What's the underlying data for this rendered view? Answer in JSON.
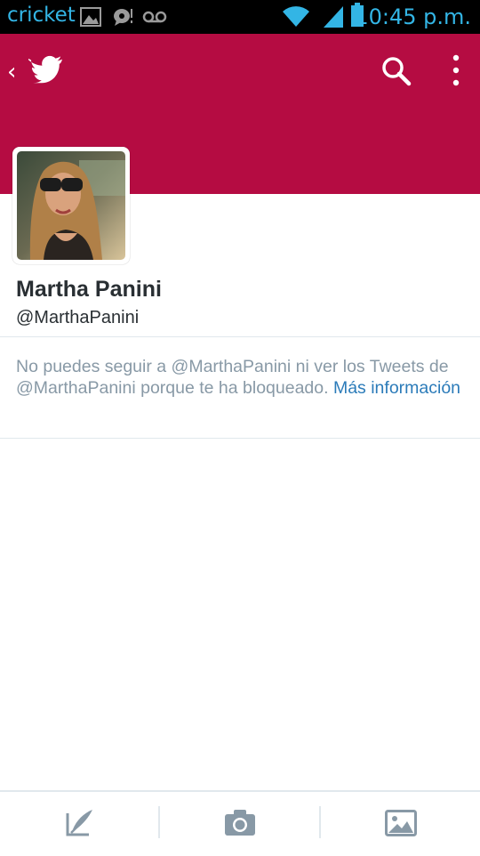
{
  "status_bar": {
    "carrier": "cricket",
    "time": "10:45 p.m.",
    "icons": [
      "image-notification-icon",
      "chat-notification-icon",
      "voicemail-icon",
      "wifi-icon",
      "signal-icon",
      "battery-icon"
    ]
  },
  "app_bar": {
    "back_glyph": "‹",
    "icons": [
      "back-icon",
      "twitter-bird-icon",
      "search-icon",
      "overflow-menu-icon"
    ]
  },
  "profile": {
    "name": "Martha Panini",
    "handle": "@MarthaPanini"
  },
  "notice": {
    "text": "No puedes seguir a @MarthaPanini ni ver los Tweets de @MarthaPanini porque te ha bloqueado. ",
    "link": "Más información"
  },
  "bottom_bar": {
    "icons": [
      "compose-tweet-icon",
      "camera-icon",
      "gallery-icon"
    ]
  },
  "colors": {
    "header": "#b50c42",
    "status_bar": "#000000",
    "status_text": "#33b5e5",
    "link": "#2b7bb9",
    "muted_text": "#8899a6",
    "name_text": "#292f33"
  }
}
